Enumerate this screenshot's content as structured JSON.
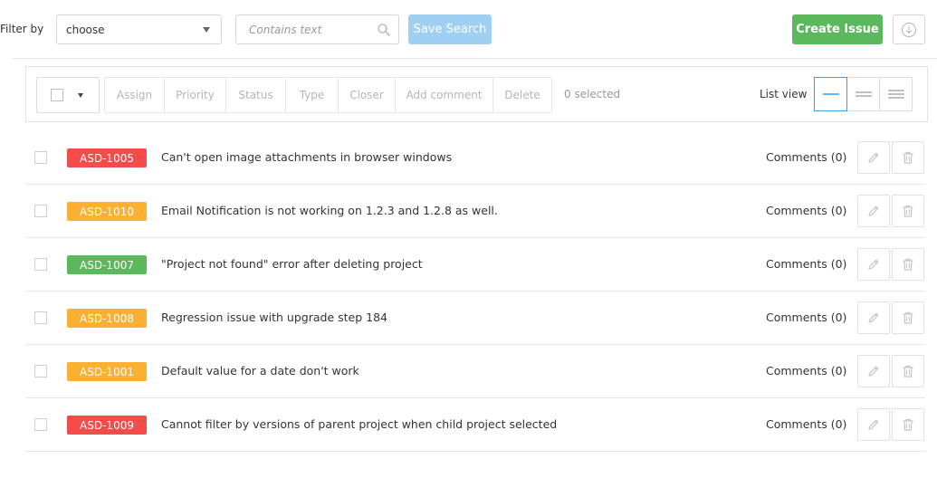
{
  "filter": {
    "label": "Filter by",
    "select_value": "choose",
    "search_placeholder": "Contains text",
    "save_label": "Save Search"
  },
  "header": {
    "create_label": "Create Issue"
  },
  "toolbar": {
    "actions": [
      "Assign",
      "Priority",
      "Status",
      "Type",
      "Closer",
      "Add comment",
      "Delete"
    ],
    "selected_text": "0 selected",
    "list_view_label": "List view"
  },
  "colors": {
    "red": "#f44b4b",
    "orange": "#fbb034",
    "green": "#5cb85c",
    "accent_blue": "#3b9ae1"
  },
  "issues": [
    {
      "id": "ASD-1005",
      "title": "Can't open image attachments in browser windows",
      "comments": "Comments (0)",
      "color": "#f44b4b"
    },
    {
      "id": "ASD-1010",
      "title": "Email Notification is not working on 1.2.3 and 1.2.8 as well.",
      "comments": "Comments (0)",
      "color": "#fbb034"
    },
    {
      "id": "ASD-1007",
      "title": "\"Project not found\" error after deleting project",
      "comments": "Comments (0)",
      "color": "#5cb85c"
    },
    {
      "id": "ASD-1008",
      "title": "Regression issue with upgrade step 184",
      "comments": "Comments (0)",
      "color": "#fbb034"
    },
    {
      "id": "ASD-1001",
      "title": "Default value for a date don't work",
      "comments": "Comments (0)",
      "color": "#fbb034"
    },
    {
      "id": "ASD-1009",
      "title": "Cannot filter by versions of parent project when child project selected",
      "comments": "Comments (0)",
      "color": "#f44b4b"
    }
  ]
}
